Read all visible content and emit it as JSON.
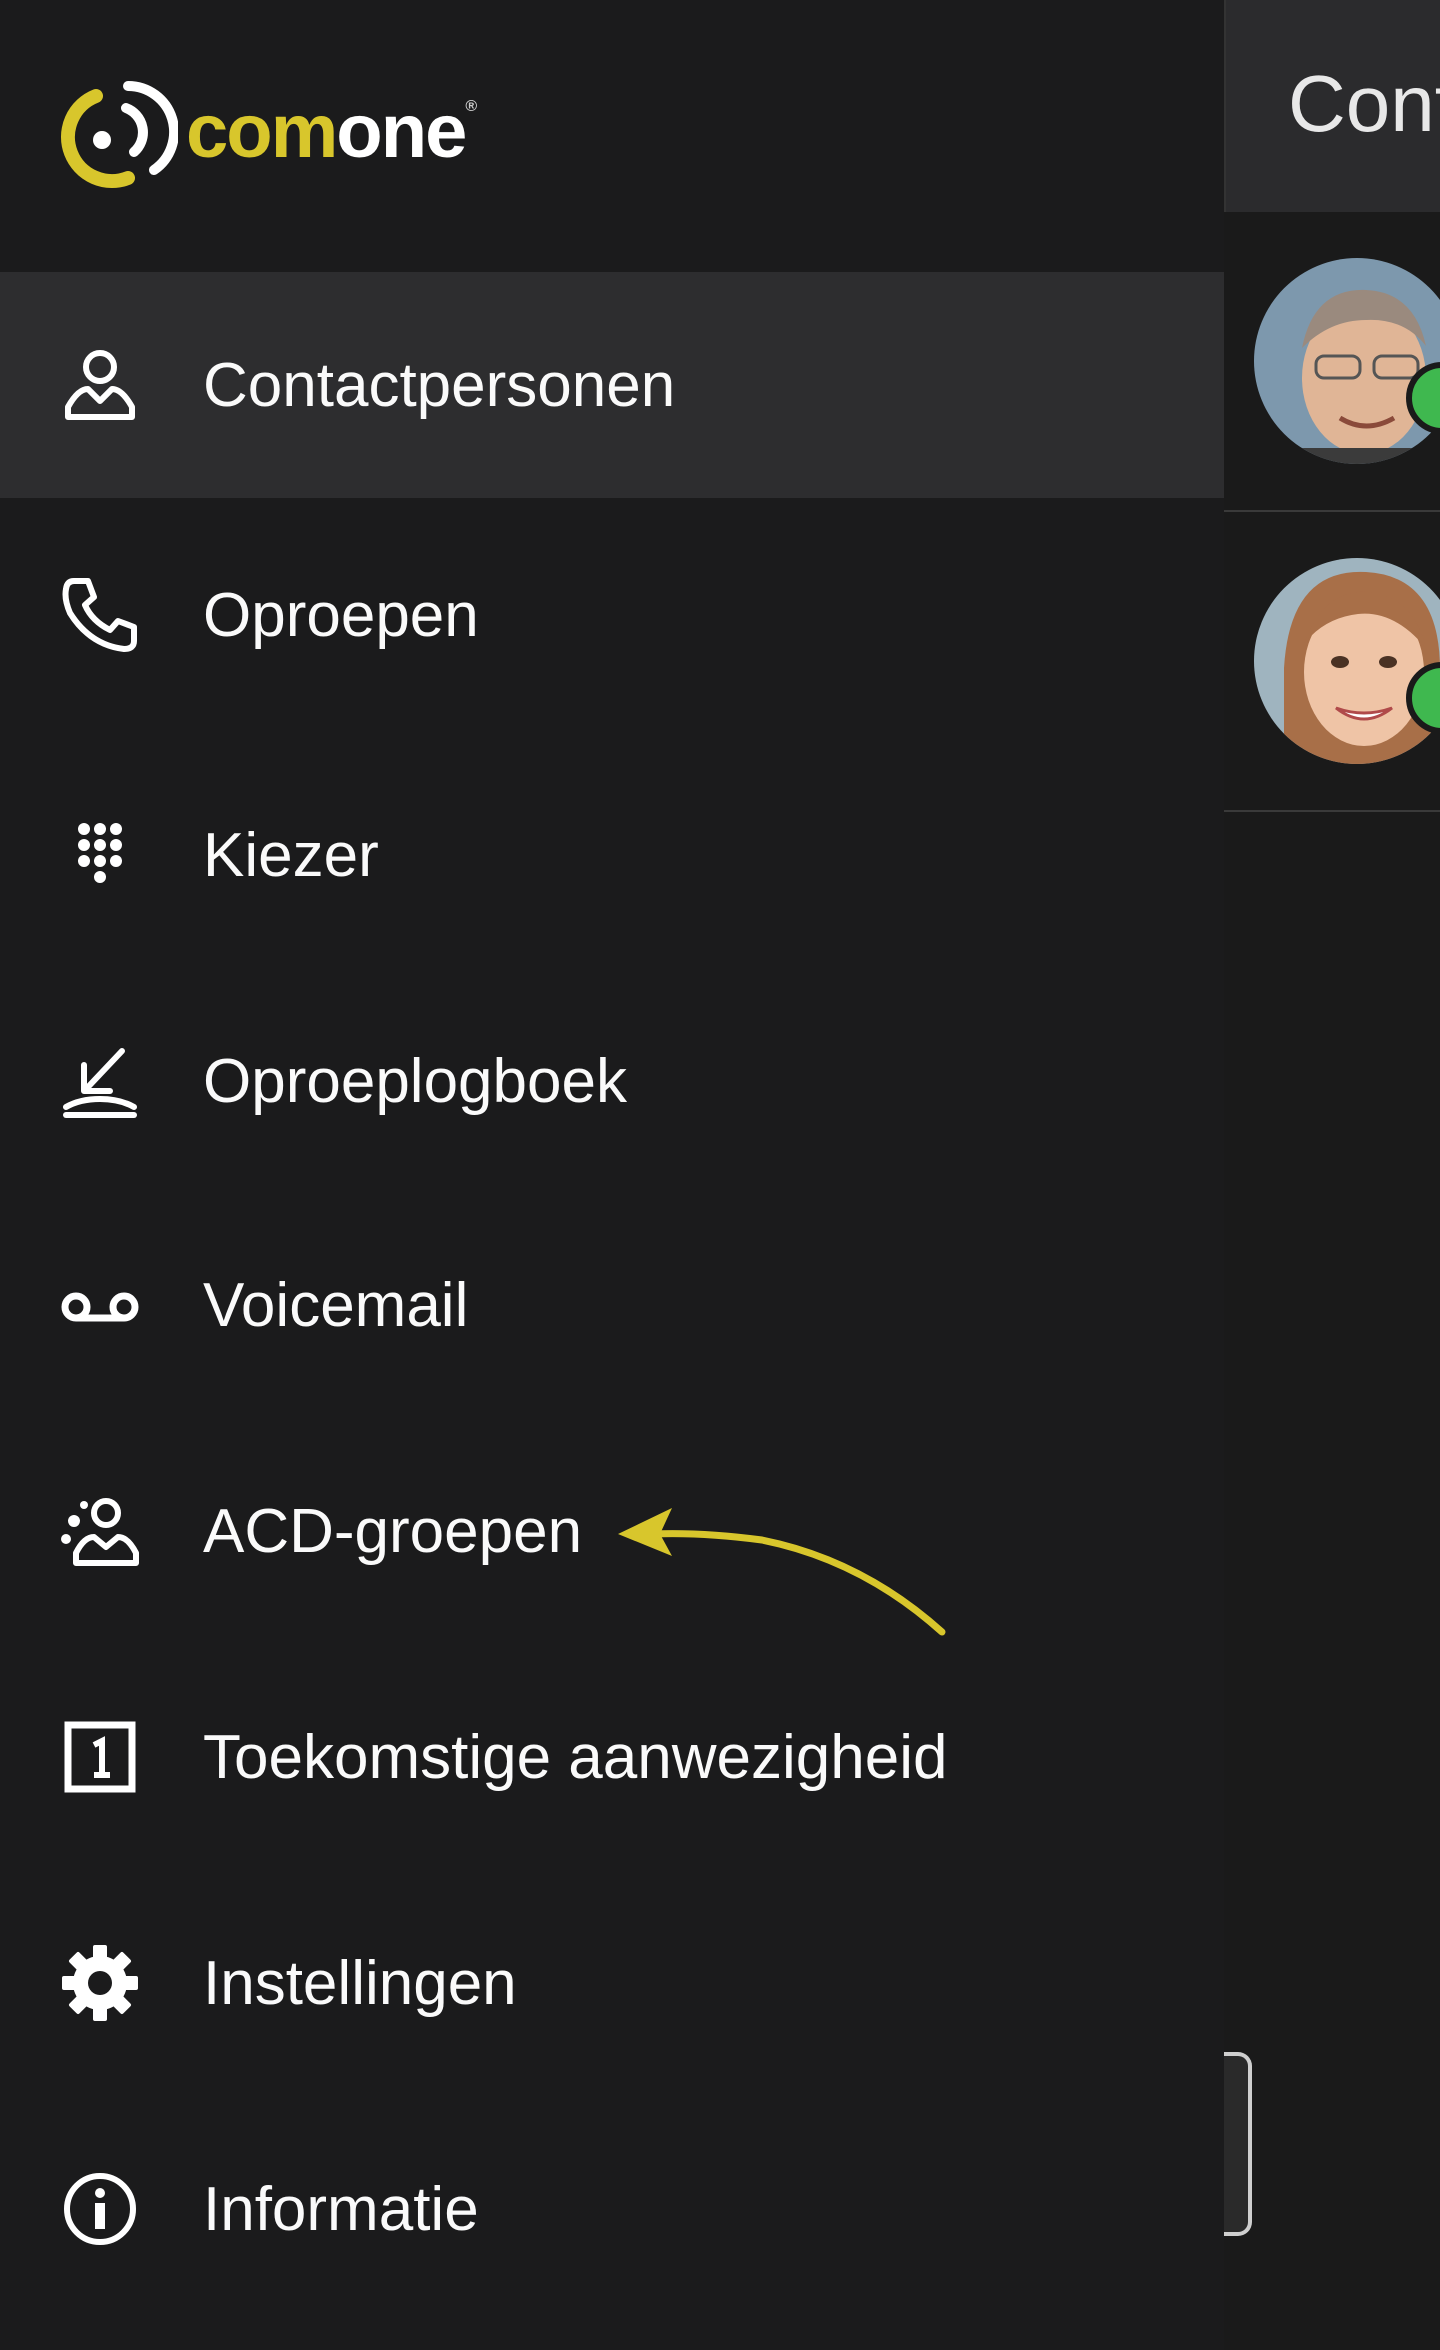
{
  "app": {
    "logo_text_accent": "com",
    "logo_text_main": "one",
    "logo_reg": "®",
    "brand_color": "#d8c62c"
  },
  "content": {
    "title": "Cont"
  },
  "nav": {
    "items": [
      {
        "label": "Contactpersonen",
        "icon": "person-icon"
      },
      {
        "label": "Oproepen",
        "icon": "phone-icon"
      },
      {
        "label": "Kiezer",
        "icon": "dialpad-icon"
      },
      {
        "label": "Oproeplogboek",
        "icon": "call-log-icon"
      },
      {
        "label": "Voicemail",
        "icon": "voicemail-icon"
      },
      {
        "label": "ACD-groepen",
        "icon": "group-icon"
      },
      {
        "label": "Toekomstige aanwezigheid",
        "icon": "calendar-icon"
      },
      {
        "label": "Instellingen",
        "icon": "gear-icon"
      },
      {
        "label": "Informatie",
        "icon": "info-icon"
      }
    ]
  },
  "colors": {
    "status_online": "#3fb84f",
    "annotation_arrow": "#d8c62c"
  }
}
